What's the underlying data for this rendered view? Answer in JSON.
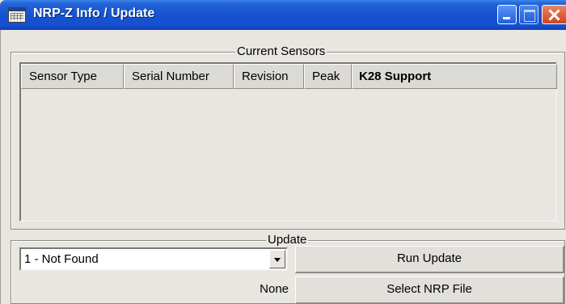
{
  "window": {
    "title": "NRP-Z Info / Update",
    "icon": "grid-window-icon"
  },
  "sensors": {
    "legend": "Current Sensors",
    "columns": [
      "Sensor Type",
      "Serial Number",
      "Revision",
      "Peak",
      "K28 Support"
    ],
    "rows": []
  },
  "update": {
    "legend": "Update",
    "sensor_select_value": "1 - Not Found",
    "run_label": "Run Update",
    "file_value": "None",
    "select_file_label": "Select NRP File"
  }
}
